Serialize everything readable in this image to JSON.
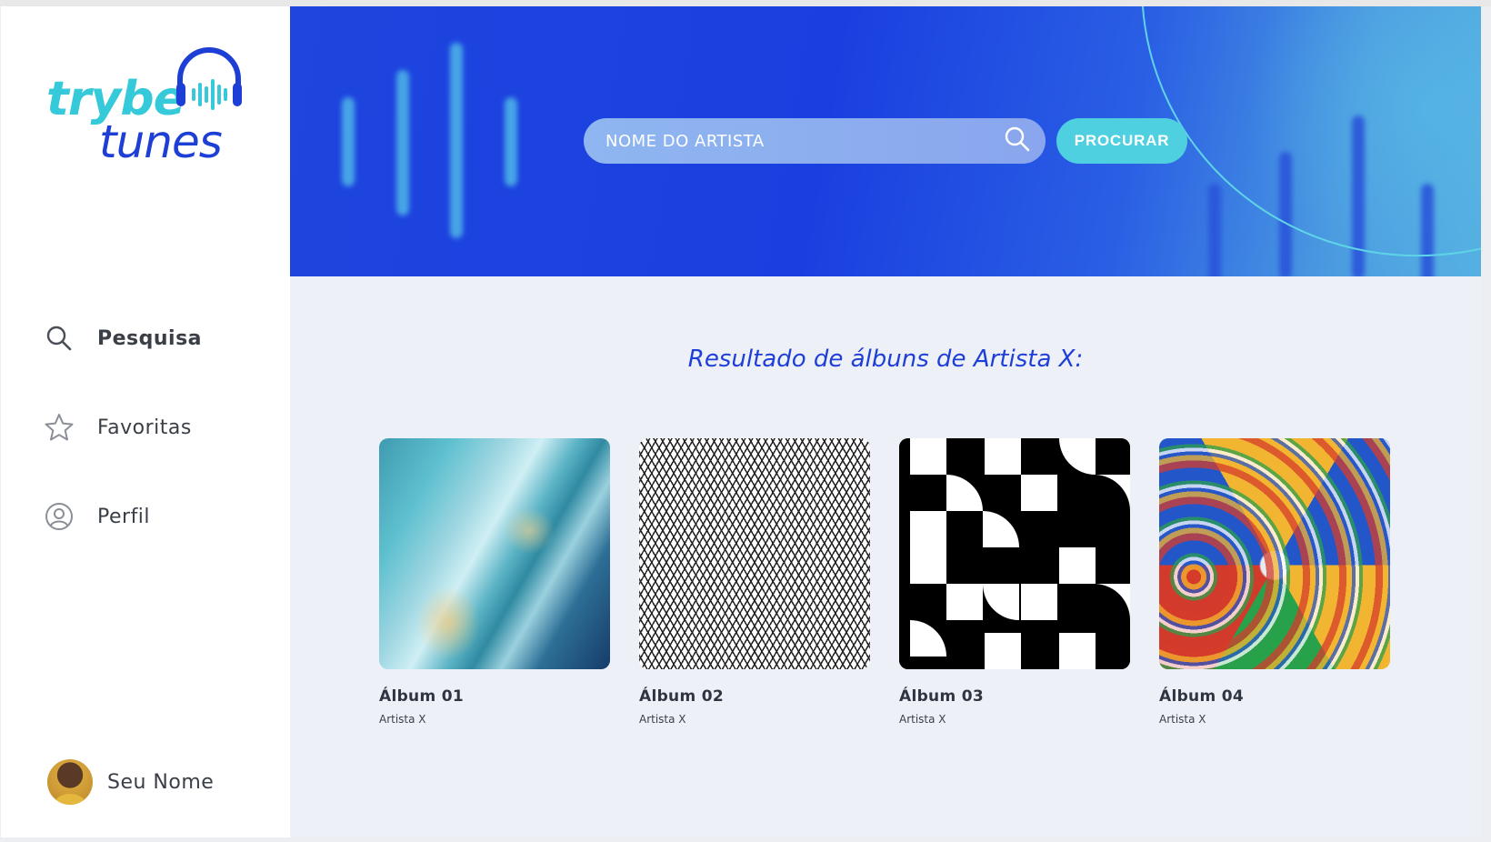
{
  "app": {
    "logo": {
      "word1": "trybe",
      "word2": "tunes"
    },
    "colors": {
      "accent": "#1d3fd6",
      "secondary": "#4fd0e0",
      "text": "#3a3f47"
    }
  },
  "sidebar": {
    "items": [
      {
        "label": "Pesquisa",
        "icon": "search-icon",
        "active": true
      },
      {
        "label": "Favoritas",
        "icon": "star-icon",
        "active": false
      },
      {
        "label": "Perfil",
        "icon": "profile-icon",
        "active": false
      }
    ],
    "user": {
      "name": "Seu Nome"
    }
  },
  "search": {
    "placeholder": "NOME DO ARTISTA",
    "button_label": "PROCURAR"
  },
  "results": {
    "title": "Resultado de álbuns de Artista X:",
    "albums": [
      {
        "title": "Álbum 01",
        "artist": "Artista X"
      },
      {
        "title": "Álbum 02",
        "artist": "Artista X"
      },
      {
        "title": "Álbum 03",
        "artist": "Artista X"
      },
      {
        "title": "Álbum 04",
        "artist": "Artista X"
      }
    ]
  }
}
